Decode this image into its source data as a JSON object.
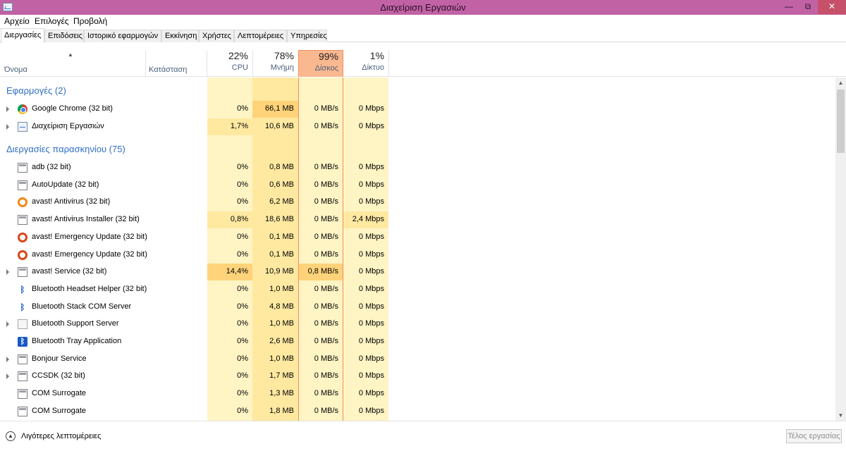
{
  "window": {
    "title": "Διαχείριση Εργασιών",
    "minimize": "—",
    "maximize": "⧉",
    "close": "✕"
  },
  "menu": [
    "Αρχείο",
    "Επιλογές",
    "Προβολή"
  ],
  "tabs": [
    "Διεργασίες",
    "Επιδόσεις",
    "Ιστορικό εφαρμογών",
    "Εκκίνηση",
    "Χρήστες",
    "Λεπτομέρειες",
    "Υπηρεσίες"
  ],
  "active_tab": "Διεργασίες",
  "columns": {
    "name": "Όνομα",
    "status": "Κατάσταση",
    "cpu": {
      "pct": "22%",
      "label": "CPU"
    },
    "memory": {
      "pct": "78%",
      "label": "Μνήμη"
    },
    "disk": {
      "pct": "99%",
      "label": "Δίσκος"
    },
    "network": {
      "pct": "1%",
      "label": "Δίκτυο"
    }
  },
  "groups": {
    "apps": "Εφαρμογές (2)",
    "background": "Διεργασίες παρασκηνίου (75)"
  },
  "apps": [
    {
      "name": "Google Chrome (32 bit)",
      "icon": "chrome-icon",
      "expandable": true,
      "cpu": "0%",
      "memory": "66,1 MB",
      "disk": "0 MB/s",
      "network": "0 Mbps"
    },
    {
      "name": "Διαχείριση Εργασιών",
      "icon": "task-manager-icon",
      "expandable": true,
      "cpu": "1,7%",
      "memory": "10,6 MB",
      "disk": "0 MB/s",
      "network": "0 Mbps"
    }
  ],
  "background": [
    {
      "name": "adb (32 bit)",
      "icon": "window-icon",
      "expandable": false,
      "cpu": "0%",
      "memory": "0,8 MB",
      "disk": "0 MB/s",
      "network": "0 Mbps"
    },
    {
      "name": "AutoUpdate (32 bit)",
      "icon": "window-icon",
      "expandable": false,
      "cpu": "0%",
      "memory": "0,6 MB",
      "disk": "0 MB/s",
      "network": "0 Mbps"
    },
    {
      "name": "avast! Antivirus (32 bit)",
      "icon": "avast-icon",
      "expandable": false,
      "cpu": "0%",
      "memory": "6,2 MB",
      "disk": "0 MB/s",
      "network": "0 Mbps"
    },
    {
      "name": "avast! Antivirus Installer (32 bit)",
      "icon": "window-icon",
      "expandable": false,
      "cpu": "0,8%",
      "memory": "18,6 MB",
      "disk": "0 MB/s",
      "network": "2,4 Mbps"
    },
    {
      "name": "avast! Emergency Update (32 bit)",
      "icon": "avast-red-icon",
      "expandable": false,
      "cpu": "0%",
      "memory": "0,1 MB",
      "disk": "0 MB/s",
      "network": "0 Mbps"
    },
    {
      "name": "avast! Emergency Update (32 bit)",
      "icon": "avast-red-icon",
      "expandable": false,
      "cpu": "0%",
      "memory": "0,1 MB",
      "disk": "0 MB/s",
      "network": "0 Mbps"
    },
    {
      "name": "avast! Service (32 bit)",
      "icon": "window-icon",
      "expandable": true,
      "cpu": "14,4%",
      "memory": "10,9 MB",
      "disk": "0,8 MB/s",
      "network": "0 Mbps"
    },
    {
      "name": "Bluetooth Headset Helper (32 bit)",
      "icon": "bluetooth-icon",
      "expandable": false,
      "cpu": "0%",
      "memory": "1,0 MB",
      "disk": "0 MB/s",
      "network": "0 Mbps"
    },
    {
      "name": "Bluetooth Stack COM Server",
      "icon": "bluetooth-icon",
      "expandable": false,
      "cpu": "0%",
      "memory": "4,8 MB",
      "disk": "0 MB/s",
      "network": "0 Mbps"
    },
    {
      "name": "Bluetooth Support Server",
      "icon": "paper-icon",
      "expandable": true,
      "cpu": "0%",
      "memory": "1,0 MB",
      "disk": "0 MB/s",
      "network": "0 Mbps"
    },
    {
      "name": "Bluetooth Tray Application",
      "icon": "bluetooth-box-icon",
      "expandable": false,
      "cpu": "0%",
      "memory": "2,6 MB",
      "disk": "0 MB/s",
      "network": "0 Mbps"
    },
    {
      "name": "Bonjour Service",
      "icon": "window-icon",
      "expandable": true,
      "cpu": "0%",
      "memory": "1,0 MB",
      "disk": "0 MB/s",
      "network": "0 Mbps"
    },
    {
      "name": "CCSDK (32 bit)",
      "icon": "window-icon",
      "expandable": true,
      "cpu": "0%",
      "memory": "1,7 MB",
      "disk": "0 MB/s",
      "network": "0 Mbps"
    },
    {
      "name": "COM Surrogate",
      "icon": "window-icon",
      "expandable": false,
      "cpu": "0%",
      "memory": "1,3 MB",
      "disk": "0 MB/s",
      "network": "0 Mbps"
    },
    {
      "name": "COM Surrogate",
      "icon": "window-icon",
      "expandable": false,
      "cpu": "0%",
      "memory": "1,8 MB",
      "disk": "0 MB/s",
      "network": "0 Mbps"
    }
  ],
  "footer": {
    "fewer_details": "Λιγότερες λεπτομέρειες",
    "end_task": "Τέλος εργασίας"
  },
  "colors": {
    "titlebar": "#c162a5",
    "heat_low": "#fff4c4",
    "heat_mid": "#ffe9a1",
    "heat_high": "#ffd37a",
    "disk_header": "#f9b890",
    "disk_border": "#f08f5d",
    "group_text": "#2f6fc4"
  }
}
